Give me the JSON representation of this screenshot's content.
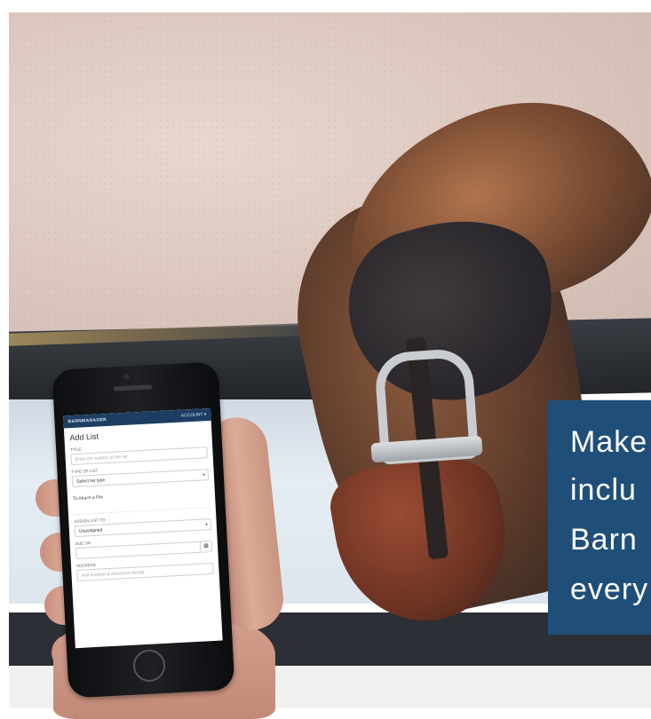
{
  "phone_app": {
    "logo_text": "BARNMANAGER",
    "account_label": "ACCOUNT ▾",
    "form_title": "Add List",
    "title_label": "TITLE",
    "title_placeholder": "Enter the subject of the list",
    "type_label": "TYPE OF LIST",
    "type_value": "Select list type",
    "attach_label": "To Attach a File",
    "assign_label": "ASSIGN LIST TO",
    "assign_value": "Unassigned",
    "due_label": "DUE ON",
    "address_label": "ADDRESS",
    "address_placeholder": "Add location & directions details"
  },
  "callout": {
    "lines": [
      "Make",
      "inclu",
      "Barn",
      "every"
    ],
    "background_color": "#1f4f79",
    "text_color": "#ffffff"
  },
  "icons": {
    "calendar": "calendar-icon",
    "dropdown": "chevron-down-icon"
  }
}
